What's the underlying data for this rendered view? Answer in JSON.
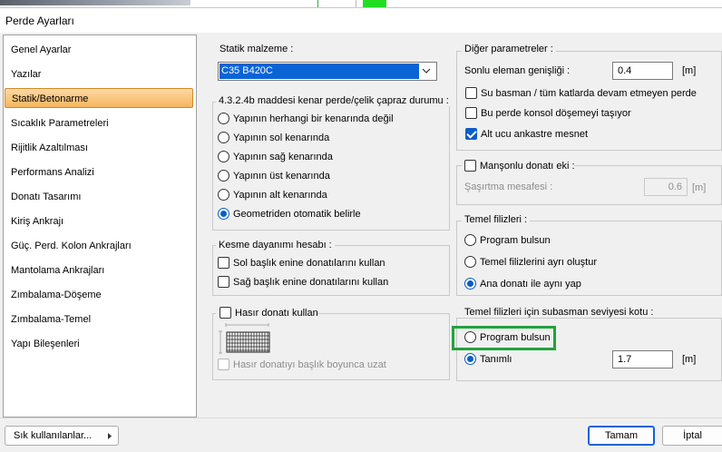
{
  "window": {
    "title": "Perde Ayarları"
  },
  "sidebar": {
    "items": [
      {
        "label": "Genel Ayarlar"
      },
      {
        "label": "Yazılar"
      },
      {
        "label": "Statik/Betonarme"
      },
      {
        "label": "Sıcaklık Parametreleri"
      },
      {
        "label": "Rijitlik Azaltılması"
      },
      {
        "label": "Performans Analizi"
      },
      {
        "label": "Donatı Tasarımı"
      },
      {
        "label": "Kiriş Ankrajı"
      },
      {
        "label": "Güç. Perd. Kolon Ankrajları"
      },
      {
        "label": "Mantolama Ankrajları"
      },
      {
        "label": "Zımbalama-Döşeme"
      },
      {
        "label": "Zımbalama-Temel"
      },
      {
        "label": "Yapı Bileşenleri"
      }
    ],
    "active": "Statik/Betonarme"
  },
  "statik": {
    "title": "Statik malzeme :",
    "material": "C35 B420C"
  },
  "kenar": {
    "title": "4.3.2.4b maddesi kenar perde/çelik çapraz durumu :",
    "options": [
      {
        "label": "Yapının herhangi bir kenarında değil",
        "selected": false
      },
      {
        "label": "Yapının sol kenarında",
        "selected": false
      },
      {
        "label": "Yapının sağ kenarında",
        "selected": false
      },
      {
        "label": "Yapının üst kenarında",
        "selected": false
      },
      {
        "label": "Yapının alt kenarında",
        "selected": false
      },
      {
        "label": "Geometriden otomatik belirle",
        "selected": true
      }
    ]
  },
  "kesme": {
    "title": "Kesme dayanımı hesabı :",
    "options": [
      {
        "label": "Sol başlık enine donatılarını kullan",
        "checked": false
      },
      {
        "label": "Sağ başlık enine donatılarını kullan",
        "checked": false
      }
    ]
  },
  "hasir": {
    "title": "Hasır donatı kullan",
    "checked": false,
    "sub_label": "Hasır donatıyı başlık boyunca uzat"
  },
  "diger": {
    "title": "Diğer parametreler :",
    "sonlu_label": "Sonlu eleman genişliği :",
    "sonlu_value": "0.4",
    "unit": "[m]",
    "checks": [
      {
        "label": "Su basman / tüm katlarda devam etmeyen perde",
        "checked": false
      },
      {
        "label": "Bu perde konsol döşemeyi taşıyor",
        "checked": false
      },
      {
        "label": "Alt ucu ankastre mesnet",
        "checked": true
      }
    ]
  },
  "manson": {
    "title": "Manşonlu donatı eki :",
    "checked": false,
    "label": "Şaşırtma mesafesi :",
    "value": "0.6",
    "unit": "[m]"
  },
  "temel": {
    "title": "Temel filizleri :",
    "options": [
      {
        "label": "Program bulsun",
        "selected": false
      },
      {
        "label": "Temel filizlerini ayrı oluştur",
        "selected": false
      },
      {
        "label": "Ana donatı ile aynı yap",
        "selected": true
      }
    ]
  },
  "subasman": {
    "title": "Temel filizleri için subasman seviyesi kotu  :",
    "program_label": "Program bulsun",
    "tanimli_label": "Tanımlı",
    "value": "1.7",
    "unit": "[m]"
  },
  "footer": {
    "favorites": "Sık kullanılanlar...",
    "ok": "Tamam",
    "cancel": "İptal"
  },
  "colors": {
    "accent": "#0a64d6",
    "highlight": "#22a33c",
    "active_item": "#f6b55f"
  }
}
